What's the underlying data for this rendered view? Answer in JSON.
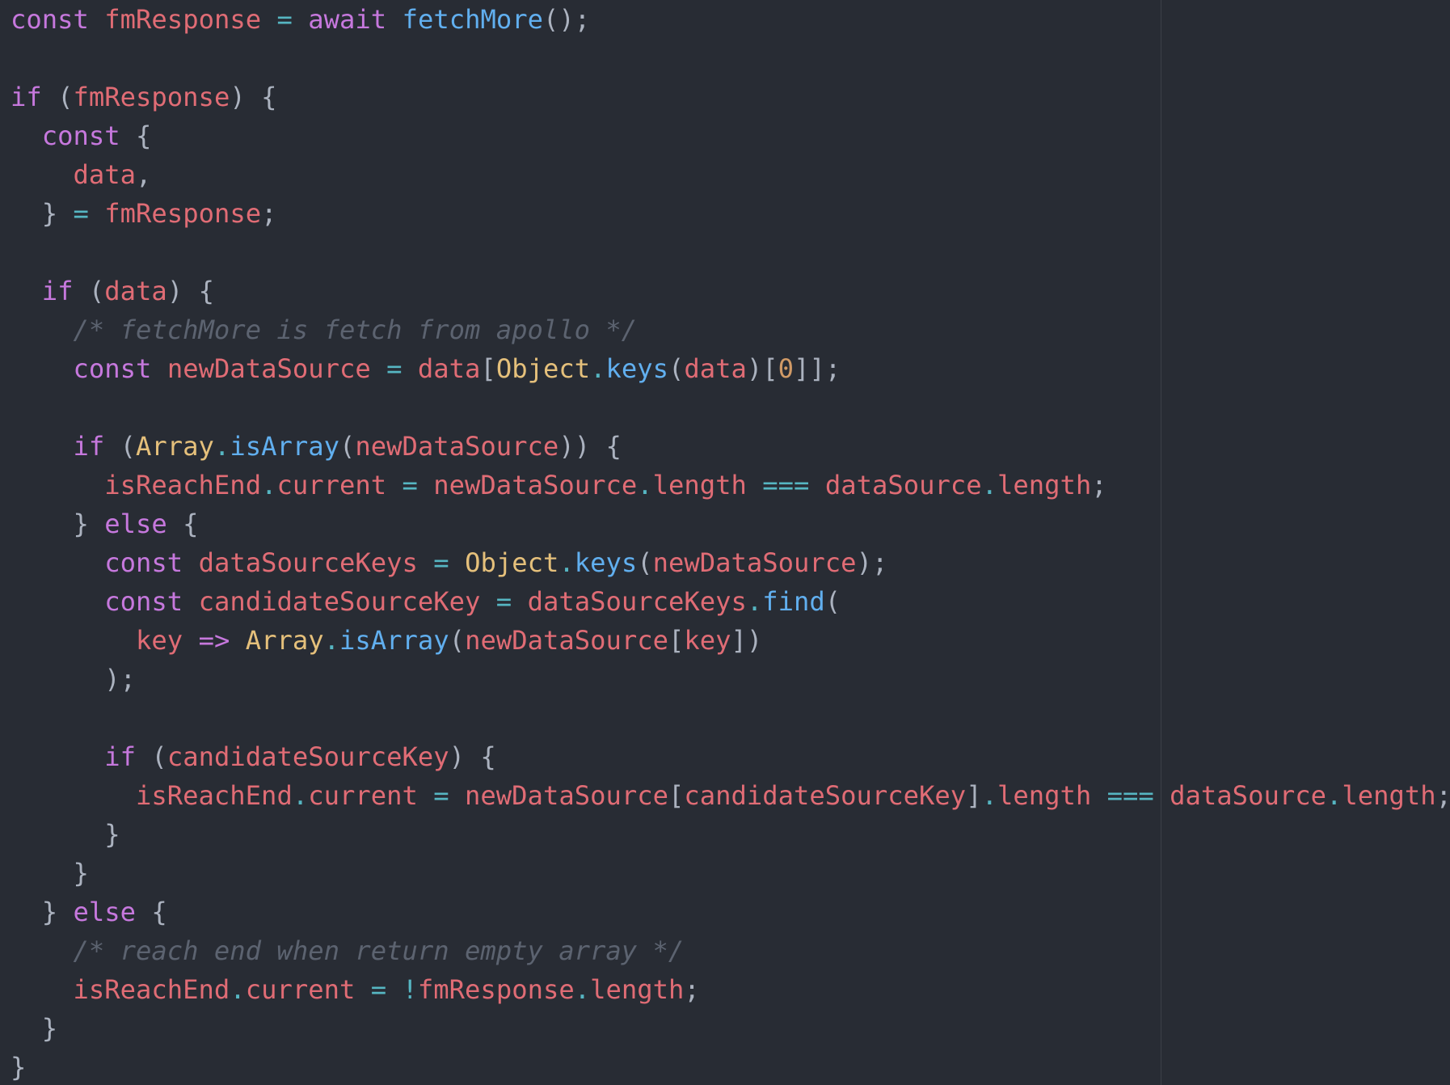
{
  "colors": {
    "background": "#282c34",
    "keyword": "#c678dd",
    "variable": "#e06c75",
    "function": "#61afef",
    "class": "#e5c07b",
    "number": "#d19a66",
    "operator": "#56b6c2",
    "punctuation": "#abb2bf",
    "comment": "#5c6370"
  },
  "code_lines": [
    [
      [
        "kw",
        "const"
      ],
      [
        "pun",
        " "
      ],
      [
        "var",
        "fmResponse"
      ],
      [
        "pun",
        " "
      ],
      [
        "op",
        "="
      ],
      [
        "pun",
        " "
      ],
      [
        "kw",
        "await"
      ],
      [
        "pun",
        " "
      ],
      [
        "fn",
        "fetchMore"
      ],
      [
        "pun",
        "();"
      ]
    ],
    [],
    [
      [
        "kw",
        "if"
      ],
      [
        "pun",
        " ("
      ],
      [
        "var",
        "fmResponse"
      ],
      [
        "pun",
        ") {"
      ]
    ],
    [
      [
        "pun",
        "  "
      ],
      [
        "kw",
        "const"
      ],
      [
        "pun",
        " {"
      ]
    ],
    [
      [
        "pun",
        "    "
      ],
      [
        "var",
        "data"
      ],
      [
        "pun",
        ","
      ]
    ],
    [
      [
        "pun",
        "  } "
      ],
      [
        "op",
        "="
      ],
      [
        "pun",
        " "
      ],
      [
        "var",
        "fmResponse"
      ],
      [
        "pun",
        ";"
      ]
    ],
    [],
    [
      [
        "pun",
        "  "
      ],
      [
        "kw",
        "if"
      ],
      [
        "pun",
        " ("
      ],
      [
        "var",
        "data"
      ],
      [
        "pun",
        ") {"
      ]
    ],
    [
      [
        "pun",
        "    "
      ],
      [
        "cm",
        "/* fetchMore is fetch from apollo */"
      ]
    ],
    [
      [
        "pun",
        "    "
      ],
      [
        "kw",
        "const"
      ],
      [
        "pun",
        " "
      ],
      [
        "var",
        "newDataSource"
      ],
      [
        "pun",
        " "
      ],
      [
        "op",
        "="
      ],
      [
        "pun",
        " "
      ],
      [
        "var",
        "data"
      ],
      [
        "pun",
        "["
      ],
      [
        "cls",
        "Object"
      ],
      [
        "op",
        "."
      ],
      [
        "fn",
        "keys"
      ],
      [
        "pun",
        "("
      ],
      [
        "var",
        "data"
      ],
      [
        "pun",
        ")["
      ],
      [
        "num",
        "0"
      ],
      [
        "pun",
        "]];"
      ]
    ],
    [],
    [
      [
        "pun",
        "    "
      ],
      [
        "kw",
        "if"
      ],
      [
        "pun",
        " ("
      ],
      [
        "cls",
        "Array"
      ],
      [
        "op",
        "."
      ],
      [
        "fn",
        "isArray"
      ],
      [
        "pun",
        "("
      ],
      [
        "var",
        "newDataSource"
      ],
      [
        "pun",
        ")) {"
      ]
    ],
    [
      [
        "pun",
        "      "
      ],
      [
        "var",
        "isReachEnd"
      ],
      [
        "op",
        "."
      ],
      [
        "var",
        "current"
      ],
      [
        "pun",
        " "
      ],
      [
        "op",
        "="
      ],
      [
        "pun",
        " "
      ],
      [
        "var",
        "newDataSource"
      ],
      [
        "op",
        "."
      ],
      [
        "var",
        "length"
      ],
      [
        "pun",
        " "
      ],
      [
        "op",
        "==="
      ],
      [
        "pun",
        " "
      ],
      [
        "var",
        "dataSource"
      ],
      [
        "op",
        "."
      ],
      [
        "var",
        "length"
      ],
      [
        "pun",
        ";"
      ]
    ],
    [
      [
        "pun",
        "    } "
      ],
      [
        "kw",
        "else"
      ],
      [
        "pun",
        " {"
      ]
    ],
    [
      [
        "pun",
        "      "
      ],
      [
        "kw",
        "const"
      ],
      [
        "pun",
        " "
      ],
      [
        "var",
        "dataSourceKeys"
      ],
      [
        "pun",
        " "
      ],
      [
        "op",
        "="
      ],
      [
        "pun",
        " "
      ],
      [
        "cls",
        "Object"
      ],
      [
        "op",
        "."
      ],
      [
        "fn",
        "keys"
      ],
      [
        "pun",
        "("
      ],
      [
        "var",
        "newDataSource"
      ],
      [
        "pun",
        ");"
      ]
    ],
    [
      [
        "pun",
        "      "
      ],
      [
        "kw",
        "const"
      ],
      [
        "pun",
        " "
      ],
      [
        "var",
        "candidateSourceKey"
      ],
      [
        "pun",
        " "
      ],
      [
        "op",
        "="
      ],
      [
        "pun",
        " "
      ],
      [
        "var",
        "dataSourceKeys"
      ],
      [
        "op",
        "."
      ],
      [
        "fn",
        "find"
      ],
      [
        "pun",
        "("
      ]
    ],
    [
      [
        "pun",
        "        "
      ],
      [
        "var",
        "key"
      ],
      [
        "pun",
        " "
      ],
      [
        "kw",
        "=>"
      ],
      [
        "pun",
        " "
      ],
      [
        "cls",
        "Array"
      ],
      [
        "op",
        "."
      ],
      [
        "fn",
        "isArray"
      ],
      [
        "pun",
        "("
      ],
      [
        "var",
        "newDataSource"
      ],
      [
        "pun",
        "["
      ],
      [
        "var",
        "key"
      ],
      [
        "pun",
        "])"
      ]
    ],
    [
      [
        "pun",
        "      );"
      ]
    ],
    [],
    [
      [
        "pun",
        "      "
      ],
      [
        "kw",
        "if"
      ],
      [
        "pun",
        " ("
      ],
      [
        "var",
        "candidateSourceKey"
      ],
      [
        "pun",
        ") {"
      ]
    ],
    [
      [
        "pun",
        "        "
      ],
      [
        "var",
        "isReachEnd"
      ],
      [
        "op",
        "."
      ],
      [
        "var",
        "current"
      ],
      [
        "pun",
        " "
      ],
      [
        "op",
        "="
      ],
      [
        "pun",
        " "
      ],
      [
        "var",
        "newDataSource"
      ],
      [
        "pun",
        "["
      ],
      [
        "var",
        "candidateSourceKey"
      ],
      [
        "pun",
        "]"
      ],
      [
        "op",
        "."
      ],
      [
        "var",
        "length"
      ],
      [
        "pun",
        " "
      ],
      [
        "op",
        "==="
      ],
      [
        "pun",
        " "
      ],
      [
        "var",
        "dataSource"
      ],
      [
        "op",
        "."
      ],
      [
        "var",
        "length"
      ],
      [
        "pun",
        ";"
      ]
    ],
    [
      [
        "pun",
        "      }"
      ]
    ],
    [
      [
        "pun",
        "    }"
      ]
    ],
    [
      [
        "pun",
        "  } "
      ],
      [
        "kw",
        "else"
      ],
      [
        "pun",
        " {"
      ]
    ],
    [
      [
        "pun",
        "    "
      ],
      [
        "cm",
        "/* reach end when return empty array */"
      ]
    ],
    [
      [
        "pun",
        "    "
      ],
      [
        "var",
        "isReachEnd"
      ],
      [
        "op",
        "."
      ],
      [
        "var",
        "current"
      ],
      [
        "pun",
        " "
      ],
      [
        "op",
        "="
      ],
      [
        "pun",
        " "
      ],
      [
        "op",
        "!"
      ],
      [
        "var",
        "fmResponse"
      ],
      [
        "op",
        "."
      ],
      [
        "var",
        "length"
      ],
      [
        "pun",
        ";"
      ]
    ],
    [
      [
        "pun",
        "  }"
      ]
    ],
    [
      [
        "pun",
        "}"
      ]
    ]
  ]
}
